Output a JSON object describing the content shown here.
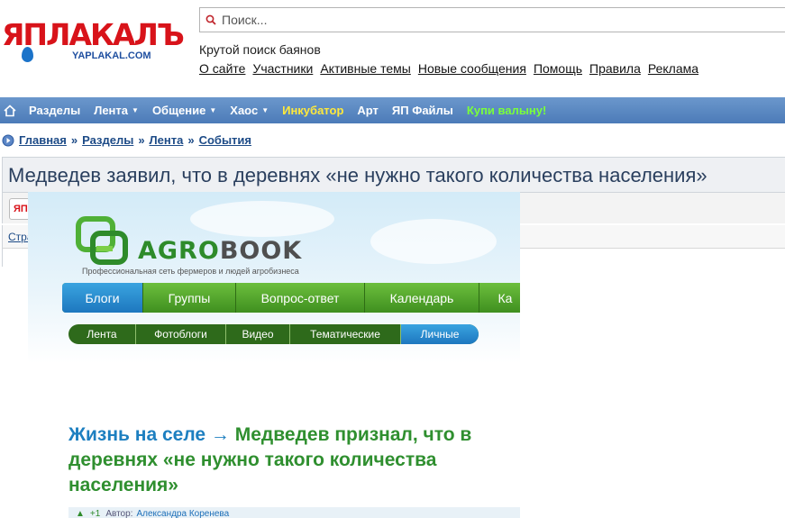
{
  "logo": {
    "text": "ЯПЛАКАЛЪ",
    "sub": "YAPLAKAL.COM"
  },
  "search": {
    "placeholder": "Поиск..."
  },
  "tagline": "Крутой поиск баянов",
  "top_links": [
    "О сайте",
    "Участники",
    "Активные темы",
    "Новые сообщения",
    "Помощь",
    "Правила",
    "Реклама"
  ],
  "nav": {
    "items": [
      {
        "label": "Разделы",
        "caret": ""
      },
      {
        "label": "Лента",
        "caret": "▼"
      },
      {
        "label": "Общение",
        "caret": "▼"
      },
      {
        "label": "Хаос",
        "caret": "▼"
      },
      {
        "label": "Инкубатор",
        "caret": ""
      },
      {
        "label": "Арт",
        "caret": ""
      },
      {
        "label": "ЯП Файлы",
        "caret": ""
      },
      {
        "label": "Купи валыну!",
        "caret": ""
      }
    ]
  },
  "breadcrumb": {
    "items": [
      "Главная",
      "Разделы",
      "Лента",
      "События"
    ],
    "separator": "»"
  },
  "page_title": "Медведев заявил, что в деревнях «не нужно такого количества населения»",
  "sub_bar": {
    "button": "ЯП",
    "link": "Стра"
  },
  "agrobook": {
    "logo_left": "AGRO",
    "logo_right": "BOOK",
    "tagline": "Профессиональная сеть фермеров и людей агробизнеса",
    "menu": [
      "Блоги",
      "Группы",
      "Вопрос-ответ",
      "Календарь",
      "Ка"
    ],
    "submenu": [
      "Лента",
      "Фотоблоги",
      "Видео",
      "Тематические",
      "Личные"
    ],
    "article": {
      "category": "Жизнь на селе",
      "arrow": "→",
      "title": "Медведев признал, что в деревнях «не нужно такого количества населения»"
    },
    "meta": {
      "votes": "+1",
      "author_label": "Автор:",
      "author": "Александра Коренева"
    }
  }
}
